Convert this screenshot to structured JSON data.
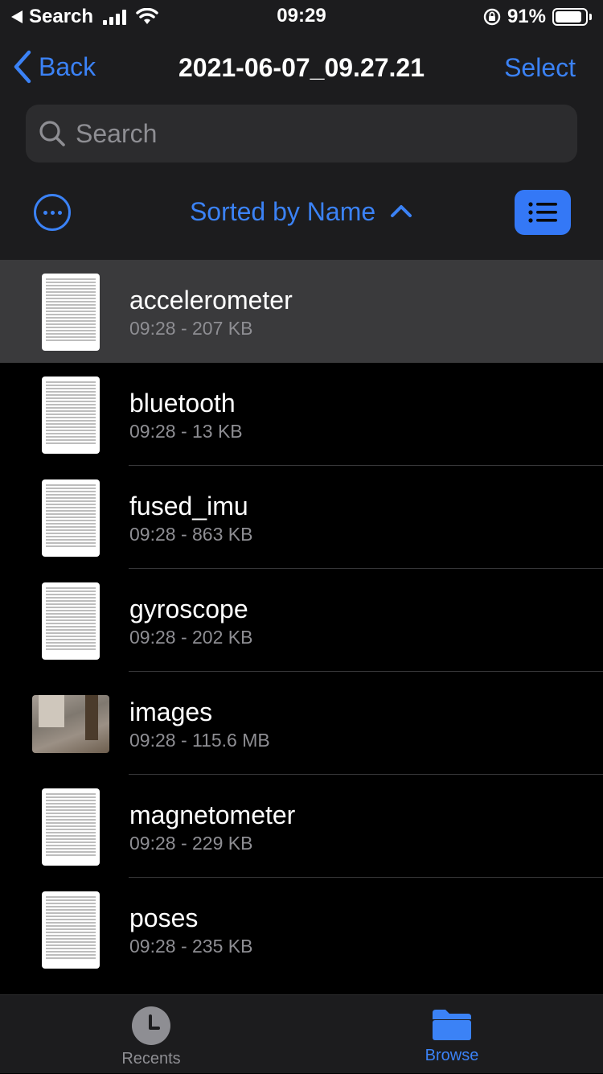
{
  "status_bar": {
    "back_app": "Search",
    "time": "09:29",
    "battery": "91%"
  },
  "nav": {
    "back_label": "Back",
    "title": "2021-06-07_09.27.21",
    "select_label": "Select"
  },
  "search": {
    "placeholder": "Search"
  },
  "sort": {
    "label": "Sorted by Name"
  },
  "files": [
    {
      "name": "accelerometer",
      "meta": "09:28 - 207 KB"
    },
    {
      "name": "bluetooth",
      "meta": "09:28 - 13 KB"
    },
    {
      "name": "fused_imu",
      "meta": "09:28 - 863 KB"
    },
    {
      "name": "gyroscope",
      "meta": "09:28 - 202 KB"
    },
    {
      "name": "images",
      "meta": "09:28 - 115.6 MB"
    },
    {
      "name": "magnetometer",
      "meta": "09:28 - 229 KB"
    },
    {
      "name": "poses",
      "meta": "09:28 - 235 KB"
    }
  ],
  "tabs": {
    "recents": "Recents",
    "browse": "Browse"
  },
  "colors": {
    "accent": "#3b82f6",
    "background": "#000000",
    "header": "#1c1c1e",
    "selected_row": "#3a3a3c"
  }
}
